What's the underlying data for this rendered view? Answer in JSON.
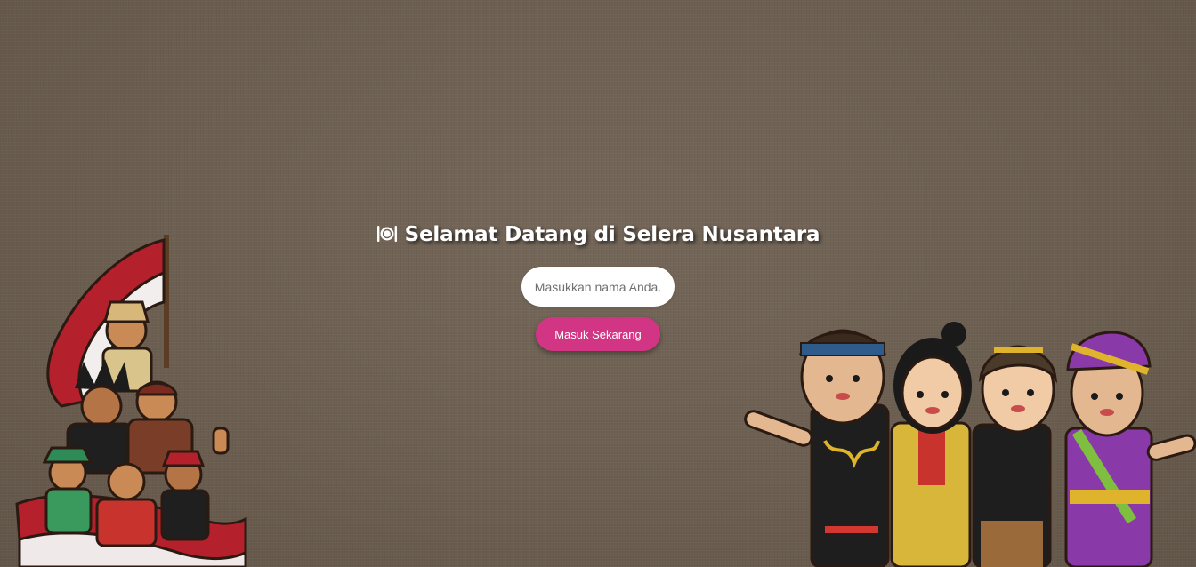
{
  "welcome": {
    "icon": "plate-utensils-icon",
    "title": "Selamat Datang di Selera Nusantara",
    "name_input": {
      "value": "",
      "placeholder": "Masukkan nama Anda."
    },
    "enter_label": "Masuk Sekarang"
  },
  "colors": {
    "background": "#6e6152",
    "accent": "#d23583",
    "title_text": "#ffffff"
  },
  "illustrations": {
    "left": "indonesian-flag-people-illustration",
    "right": "traditional-costume-children-illustration"
  }
}
